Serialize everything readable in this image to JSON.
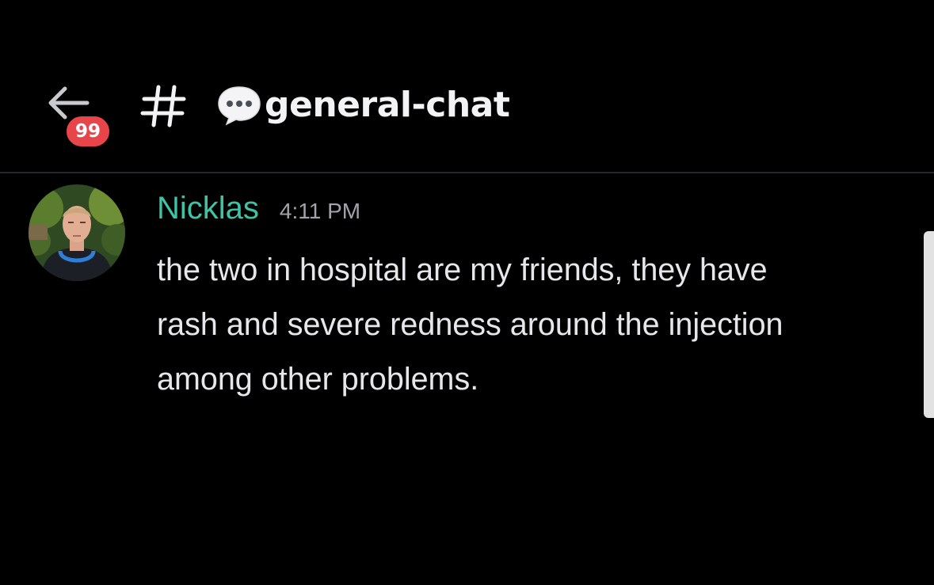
{
  "header": {
    "back_label": "Back",
    "unread_badge": "99",
    "channel_prefix": "#",
    "channel_name": "general-chat",
    "channel_emoji": "speech-bubble-icon"
  },
  "message": {
    "author": "Nicklas",
    "timestamp": "4:11 PM",
    "text": "the two in hospital are my friends, they have\nrash and severe redness around the injection\namong other problems."
  },
  "colors": {
    "background": "#000000",
    "author_name": "#3ec3a4",
    "badge": "#e8454a",
    "message_text": "#e6e7ea",
    "timestamp": "#a1a3aa"
  }
}
